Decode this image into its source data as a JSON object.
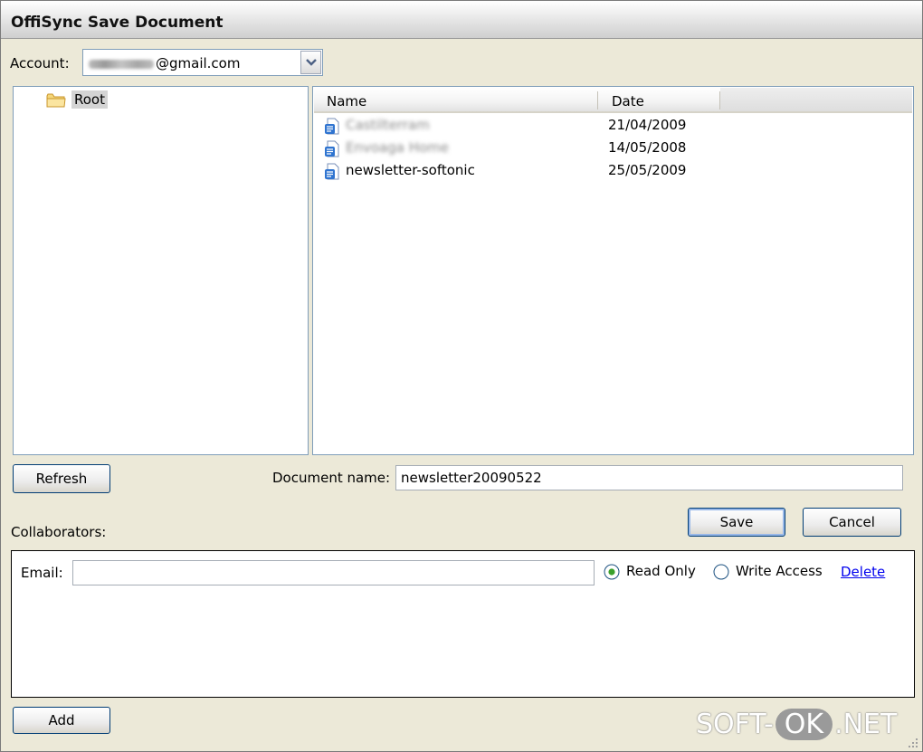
{
  "window": {
    "title": "OffiSync Save Document"
  },
  "account": {
    "label": "Account:",
    "value_suffix": "@gmail.com"
  },
  "tree": {
    "items": [
      {
        "label": "Root",
        "icon": "folder-icon"
      }
    ]
  },
  "file_list": {
    "columns": [
      "Name",
      "Date"
    ],
    "rows": [
      {
        "name": "Castilterram",
        "date": "21/04/2009",
        "blurred": true
      },
      {
        "name": "Envoaga Home",
        "date": "14/05/2008",
        "blurred": true
      },
      {
        "name": "newsletter-softonic",
        "date": "25/05/2009",
        "blurred": false
      }
    ]
  },
  "buttons": {
    "refresh": "Refresh",
    "save": "Save",
    "cancel": "Cancel",
    "add": "Add"
  },
  "document": {
    "label": "Document name:",
    "value": "newsletter20090522"
  },
  "collaborators": {
    "label": "Collaborators:",
    "email_label": "Email:",
    "email_value": "",
    "read_only_label": "Read Only",
    "write_access_label": "Write Access",
    "selected_access": "read_only",
    "delete_label": "Delete"
  },
  "watermark": {
    "left": "SOFT-",
    "middle": "OK",
    "right": ".NET"
  },
  "colors": {
    "link": "#0000ee",
    "panel_border": "#7f9db9",
    "dialog_bg": "#ece9d8"
  }
}
